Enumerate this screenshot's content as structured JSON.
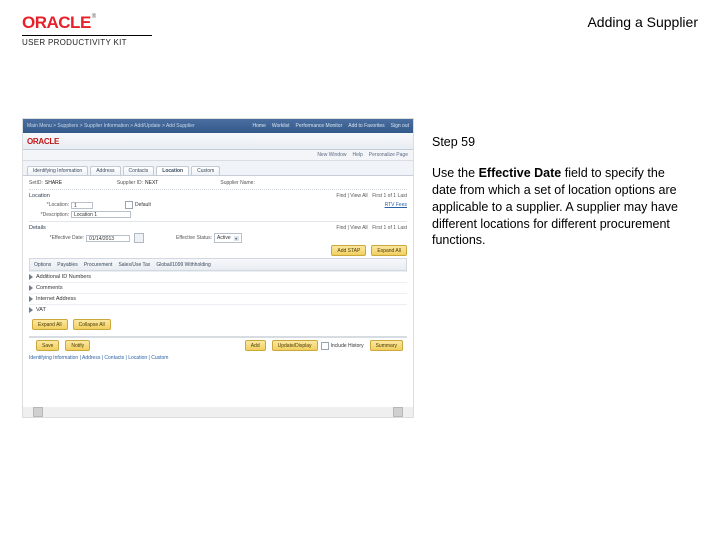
{
  "header": {
    "brand": "ORACLE",
    "brand_sup": "®",
    "brand_sub": "USER PRODUCTIVITY KIT",
    "title": "Adding a Supplier"
  },
  "instruction": {
    "step": "Step 59",
    "pre": "Use the ",
    "bold": "Effective Date",
    "post": " field to specify the date from which a set of location options are applicable to a supplier. A supplier may have different locations for different procurement functions."
  },
  "shot": {
    "breadcrumb": "Main Menu > Suppliers > Supplier Information > Add/Update > Add Supplier",
    "top_links": [
      "Home",
      "Worklist",
      "Performance Monitor",
      "Add to Favorites",
      "Sign out"
    ],
    "brand": "ORACLE",
    "subheader": [
      "New Window",
      "Help",
      "Personalize Page"
    ],
    "tabs": [
      "Identifying Information",
      "Address",
      "Contacts",
      "Location",
      "Custom"
    ],
    "active_tab": 3,
    "setid_lbl": "SetID:",
    "setid_val": "SHARE",
    "supid_lbl": "Supplier ID:",
    "supid_val": "NEXT",
    "supname_lbl": "Supplier Name:",
    "supname_val": " ",
    "find_link": "Find | View All",
    "first_link": "First",
    "count1": "1 of 1",
    "last_link": "Last",
    "loc_header": "Location",
    "loc_lbl": "*Location:",
    "loc_val": "1",
    "default_chk": "Default",
    "desc_lbl": "*Description:",
    "desc_val": "Location 1",
    "rtv_lbl": "RTV Fees",
    "details_h": "Details",
    "eff_lbl": "*Effective Date:",
    "eff_val": "01/14/2013",
    "effstat_lbl": "Effective Status:",
    "effstat_val": "Active",
    "add_btn": "Add STAP",
    "exp_btn": "Expand All",
    "col_header": [
      "Options",
      "Payables",
      "Procurement",
      "Sales/Use Tax",
      "Global/1099 Withholding"
    ],
    "expanders": [
      "Additional ID Numbers",
      "Comments",
      "Internet Address",
      "VAT"
    ],
    "expand_all2": "Expand All",
    "collapse_all": "Collapse All",
    "save_btn": "Save",
    "notify_btn": "Notify",
    "foot_add": "Add",
    "foot_upd": "Update/Display",
    "foot_inc": "Include History",
    "foot_sum": "Summary",
    "tabstrip": "Identifying Information | Address | Contacts | Location | Custom"
  }
}
